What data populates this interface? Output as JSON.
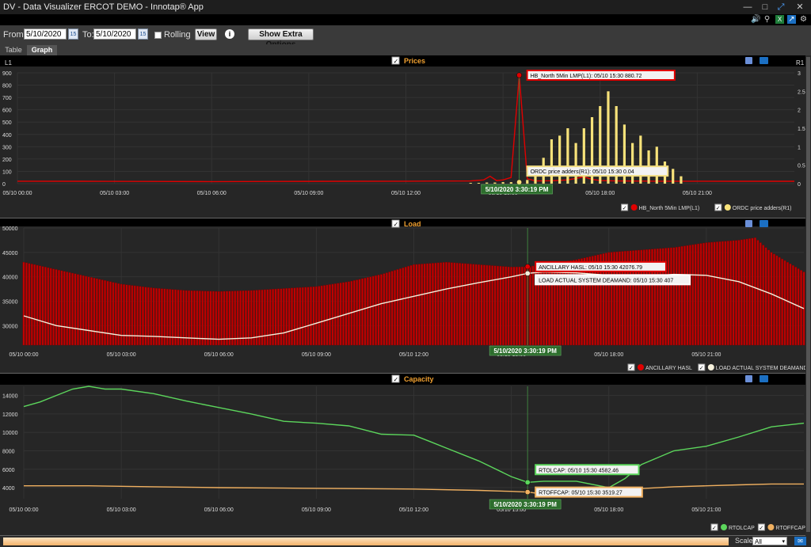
{
  "window": {
    "title": "DV - Data Visualizer ERCOT DEMO  - Innotap® App",
    "minimize": "—",
    "restore": "□",
    "close": "✕"
  },
  "toolbar_icons": [
    "volume-icon",
    "search-icon",
    "export-excel-icon",
    "export-icon",
    "settings-icon"
  ],
  "controls": {
    "from_label": "From:",
    "from_value": "5/10/2020",
    "to_label": "To:",
    "to_value": "5/10/2020",
    "calendar_glyph": "15",
    "rolling_label": "Rolling",
    "view_label": "View",
    "info_glyph": "i",
    "extra_label": "Show Extra Options"
  },
  "tabs": [
    {
      "label": "Table",
      "active": false
    },
    {
      "label": "Graph",
      "active": true
    }
  ],
  "panels": [
    {
      "title": "Prices",
      "left_axis_label": "L1",
      "right_axis_label": "R1",
      "crosshair_time": "5/10/2020 3:30:19 PM",
      "tooltips": [
        {
          "text": "HB_North 5Min LMP(L1): 05/10 15:30 880.72",
          "color": "#e00000"
        },
        {
          "text": "ORDC price adders(R1): 05/10 15:30 0.04",
          "color": "#f0dc82"
        }
      ],
      "legend": [
        {
          "label": "HB_North 5Min LMP(L1)",
          "color": "#e00000"
        },
        {
          "label": "ORDC price adders(R1)",
          "color": "#f7e27a"
        }
      ]
    },
    {
      "title": "Load",
      "crosshair_time": "5/10/2020 3:30:19 PM",
      "tooltips": [
        {
          "text": "ANCILLARY HASL: 05/10 15:30 42076.79",
          "color": "#e00000"
        },
        {
          "text": "LOAD ACTUAL SYSTEM DEAMAND: 05/10 15:30 407",
          "color": "#ffffff"
        }
      ],
      "legend": [
        {
          "label": "ANCILLARY HASL",
          "color": "#e00000"
        },
        {
          "label": "LOAD ACTUAL SYSTEM DEAMAND",
          "color": "#f5f0dc"
        }
      ]
    },
    {
      "title": "Capacity",
      "crosshair_time": "5/10/2020 3:30:19 PM",
      "tooltips": [
        {
          "text": "RTOLCAP: 05/10 15:30 4582.46",
          "color": "#5cd65c"
        },
        {
          "text": "RTOFFCAP: 05/10 15:30 3519.27",
          "color": "#f0b060"
        }
      ],
      "legend": [
        {
          "label": "RTOLCAP",
          "color": "#5cd65c"
        },
        {
          "label": "RTOFFCAP",
          "color": "#f0b060"
        }
      ]
    }
  ],
  "chart_data": [
    {
      "type": "line",
      "title": "Prices",
      "x_ticks": [
        "05/10 00:00",
        "05/10 03:00",
        "05/10 06:00",
        "05/10 09:00",
        "05/10 12:00",
        "05/10 15:00",
        "05/10 18:00",
        "05/10 21:00"
      ],
      "x_range_hours": [
        0,
        24
      ],
      "y_left": {
        "label": "L1",
        "range": [
          0,
          900
        ],
        "ticks": [
          0,
          100,
          200,
          300,
          400,
          500,
          600,
          700,
          800,
          900
        ]
      },
      "y_right": {
        "label": "R1",
        "range": [
          0,
          3
        ],
        "ticks": [
          0,
          0.5,
          1,
          1.5,
          2,
          2.5,
          3
        ]
      },
      "series": [
        {
          "name": "HB_North 5Min LMP(L1)",
          "axis": "left",
          "kind": "line",
          "points": [
            [
              0,
              20
            ],
            [
              2,
              19
            ],
            [
              4,
              18
            ],
            [
              6,
              17
            ],
            [
              8,
              18
            ],
            [
              10,
              19
            ],
            [
              12,
              20
            ],
            [
              13,
              21
            ],
            [
              14,
              22
            ],
            [
              14.4,
              30
            ],
            [
              14.6,
              60
            ],
            [
              14.8,
              25
            ],
            [
              15.0,
              30
            ],
            [
              15.25,
              50
            ],
            [
              15.5,
              880.72
            ],
            [
              15.75,
              40
            ],
            [
              16,
              22
            ],
            [
              16.5,
              24
            ],
            [
              17,
              30
            ],
            [
              17.5,
              55
            ],
            [
              17.75,
              35
            ],
            [
              18,
              25
            ],
            [
              18.5,
              22
            ],
            [
              19,
              21
            ],
            [
              20,
              20
            ],
            [
              21,
              20
            ],
            [
              22,
              19
            ],
            [
              23,
              19
            ],
            [
              24,
              19
            ]
          ]
        },
        {
          "name": "ORDC price adders(R1)",
          "axis": "right",
          "kind": "bar",
          "points": [
            [
              14.0,
              0.02
            ],
            [
              14.25,
              0.02
            ],
            [
              14.5,
              0.03
            ],
            [
              14.75,
              0.03
            ],
            [
              15.0,
              0.04
            ],
            [
              15.25,
              0.04
            ],
            [
              15.5,
              0.04
            ],
            [
              15.75,
              0.1
            ],
            [
              16.0,
              0.3
            ],
            [
              16.25,
              0.7
            ],
            [
              16.5,
              1.2
            ],
            [
              16.75,
              1.3
            ],
            [
              17.0,
              1.5
            ],
            [
              17.25,
              1.1
            ],
            [
              17.5,
              1.5
            ],
            [
              17.75,
              1.8
            ],
            [
              18.0,
              2.1
            ],
            [
              18.25,
              2.5
            ],
            [
              18.5,
              2.1
            ],
            [
              18.75,
              1.6
            ],
            [
              19.0,
              1.1
            ],
            [
              19.25,
              1.3
            ],
            [
              19.5,
              0.9
            ],
            [
              19.75,
              1.0
            ],
            [
              20.0,
              0.6
            ],
            [
              20.25,
              0.4
            ],
            [
              20.5,
              0.2
            ]
          ]
        }
      ]
    },
    {
      "type": "bar",
      "title": "Load",
      "x_ticks": [
        "05/10 00:00",
        "05/10 03:00",
        "05/10 06:00",
        "05/10 09:00",
        "05/10 12:00",
        "05/10 15:00",
        "05/10 18:00",
        "05/10 21:00"
      ],
      "x_range_hours": [
        0,
        24
      ],
      "y": {
        "range": [
          26000,
          50000
        ],
        "ticks": [
          30000,
          35000,
          40000,
          45000,
          50000
        ]
      },
      "series": [
        {
          "name": "ANCILLARY HASL",
          "kind": "bar",
          "points": [
            [
              0,
              43000
            ],
            [
              1,
              41500
            ],
            [
              2,
              40000
            ],
            [
              3,
              38500
            ],
            [
              4,
              37700
            ],
            [
              5,
              37200
            ],
            [
              6,
              37000
            ],
            [
              7,
              37200
            ],
            [
              8,
              37600
            ],
            [
              9,
              38000
            ],
            [
              10,
              39000
            ],
            [
              11,
              40500
            ],
            [
              12,
              42500
            ],
            [
              13,
              43000
            ],
            [
              14,
              42500
            ],
            [
              15,
              42000
            ],
            [
              15.5,
              42076.79
            ],
            [
              16,
              42500
            ],
            [
              17,
              43500
            ],
            [
              18,
              45000
            ],
            [
              19,
              45500
            ],
            [
              20,
              46000
            ],
            [
              21,
              47000
            ],
            [
              22,
              47500
            ],
            [
              22.5,
              48000
            ],
            [
              23,
              45000
            ],
            [
              24,
              41000
            ]
          ]
        },
        {
          "name": "LOAD ACTUAL SYSTEM DEAMAND",
          "kind": "line",
          "points": [
            [
              0,
              32000
            ],
            [
              1,
              30000
            ],
            [
              2,
              29000
            ],
            [
              3,
              28000
            ],
            [
              4,
              27800
            ],
            [
              5,
              27500
            ],
            [
              6,
              27200
            ],
            [
              7,
              27500
            ],
            [
              8,
              28500
            ],
            [
              9,
              30500
            ],
            [
              10,
              32500
            ],
            [
              11,
              34500
            ],
            [
              12,
              36000
            ],
            [
              13,
              37500
            ],
            [
              14,
              38800
            ],
            [
              15,
              40000
            ],
            [
              15.5,
              40700
            ],
            [
              16,
              41000
            ],
            [
              17,
              40800
            ],
            [
              18,
              40300
            ],
            [
              19,
              40000
            ],
            [
              20,
              40500
            ],
            [
              21,
              40300
            ],
            [
              22,
              39000
            ],
            [
              23,
              36500
            ],
            [
              24,
              33500
            ]
          ]
        }
      ]
    },
    {
      "type": "line",
      "title": "Capacity",
      "x_ticks": [
        "05/10 00:00",
        "05/10 03:00",
        "05/10 06:00",
        "05/10 09:00",
        "05/10 12:00",
        "05/10 15:00",
        "05/10 18:00",
        "05/10 21:00"
      ],
      "x_range_hours": [
        0,
        24
      ],
      "y": {
        "range": [
          2800,
          15000
        ],
        "ticks": [
          4000,
          6000,
          8000,
          10000,
          12000,
          14000
        ]
      },
      "series": [
        {
          "name": "RTOLCAP",
          "points": [
            [
              0,
              12800
            ],
            [
              0.5,
              13300
            ],
            [
              1,
              14000
            ],
            [
              1.5,
              14700
            ],
            [
              2,
              15000
            ],
            [
              2.5,
              14700
            ],
            [
              3,
              14700
            ],
            [
              4,
              14200
            ],
            [
              5,
              13400
            ],
            [
              6,
              12700
            ],
            [
              7,
              12000
            ],
            [
              8,
              11200
            ],
            [
              9,
              11000
            ],
            [
              10,
              10700
            ],
            [
              11,
              9800
            ],
            [
              12,
              9700
            ],
            [
              12.5,
              9000
            ],
            [
              13,
              8300
            ],
            [
              14,
              6900
            ],
            [
              15,
              5200
            ],
            [
              15.5,
              4582.46
            ],
            [
              16,
              4700
            ],
            [
              17,
              4700
            ],
            [
              18,
              4000
            ],
            [
              18.5,
              5000
            ],
            [
              19,
              6500
            ],
            [
              20,
              8000
            ],
            [
              21,
              8500
            ],
            [
              22,
              9500
            ],
            [
              23,
              10600
            ],
            [
              24,
              11000
            ]
          ]
        },
        {
          "name": "RTOFFCAP",
          "points": [
            [
              0,
              4200
            ],
            [
              2,
              4200
            ],
            [
              4,
              4100
            ],
            [
              6,
              4000
            ],
            [
              8,
              3950
            ],
            [
              10,
              3900
            ],
            [
              12,
              3850
            ],
            [
              14,
              3700
            ],
            [
              15,
              3600
            ],
            [
              15.5,
              3519.27
            ],
            [
              16,
              3300
            ],
            [
              17,
              3100
            ],
            [
              18,
              3300
            ],
            [
              19,
              3900
            ],
            [
              20,
              4100
            ],
            [
              21,
              4200
            ],
            [
              22,
              4300
            ],
            [
              23,
              4400
            ],
            [
              24,
              4400
            ]
          ]
        }
      ]
    }
  ]
}
